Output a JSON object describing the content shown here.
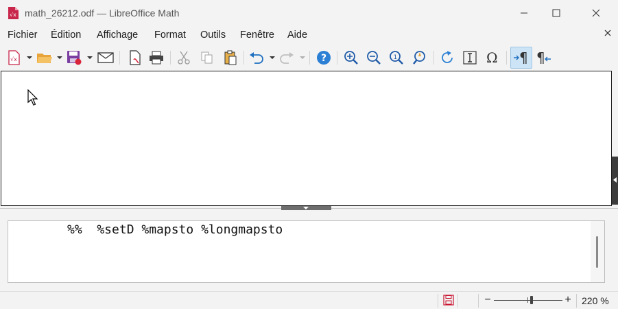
{
  "window": {
    "title": "math_26212.odf — LibreOffice Math",
    "controls": [
      "minimize-icon",
      "maximize-icon",
      "close-icon"
    ]
  },
  "menubar": {
    "items": [
      {
        "label": "Fichier"
      },
      {
        "label": "Édition"
      },
      {
        "label": "Affichage"
      },
      {
        "label": "Format"
      },
      {
        "label": "Outils"
      },
      {
        "label": "Fenêtre"
      },
      {
        "label": "Aide"
      }
    ]
  },
  "toolbar": {
    "buttons": [
      {
        "name": "new-document",
        "icon": "new-formula-icon"
      },
      {
        "name": "open",
        "icon": "folder-open-icon"
      },
      {
        "name": "save",
        "icon": "save-icon"
      },
      {
        "name": "email",
        "icon": "envelope-icon"
      },
      {
        "name": "export-pdf",
        "icon": "pdf-icon"
      },
      {
        "name": "print",
        "icon": "printer-icon"
      },
      {
        "name": "cut",
        "icon": "scissors-icon"
      },
      {
        "name": "copy",
        "icon": "copy-icon"
      },
      {
        "name": "paste",
        "icon": "paste-icon"
      },
      {
        "name": "undo",
        "icon": "undo-icon"
      },
      {
        "name": "redo",
        "icon": "redo-icon"
      },
      {
        "name": "help",
        "icon": "help-icon"
      },
      {
        "name": "zoom-in",
        "icon": "zoom-in-icon"
      },
      {
        "name": "zoom-out",
        "icon": "zoom-out-icon"
      },
      {
        "name": "zoom-100",
        "icon": "zoom-100-icon"
      },
      {
        "name": "show-all",
        "icon": "show-all-icon"
      },
      {
        "name": "update",
        "icon": "refresh-icon"
      },
      {
        "name": "formula-cursor",
        "icon": "formula-cursor-icon"
      },
      {
        "name": "symbols",
        "icon": "omega-icon"
      },
      {
        "name": "elements-dock",
        "icon": "pilcrow-dock-icon",
        "active": true
      },
      {
        "name": "elements-undock",
        "icon": "pilcrow-undock-icon"
      }
    ]
  },
  "editor": {
    "text": "%%  %setD %mapsto %longmapsto"
  },
  "statusbar": {
    "document_modified": true,
    "zoom": {
      "level": "220 %",
      "minus": "−",
      "plus": "+"
    }
  },
  "colors": {
    "accent": "#1e6fc0",
    "active_toolbar": "#cde4f7",
    "save_red": "#c8102e"
  }
}
